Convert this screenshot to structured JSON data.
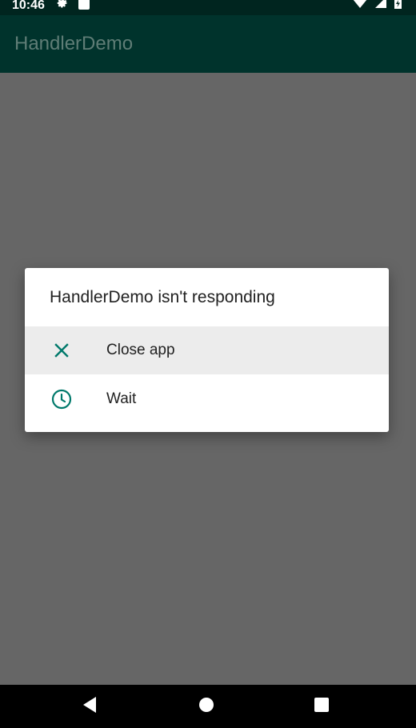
{
  "status_bar": {
    "time": "10:46",
    "left_icons": [
      "gear-icon",
      "sd-card-icon"
    ],
    "right_icons": [
      "wifi-icon",
      "cell-signal-icon",
      "battery-icon"
    ]
  },
  "app_bar": {
    "title": "HandlerDemo"
  },
  "dialog": {
    "title": "HandlerDemo isn't responding",
    "items": [
      {
        "label": "Close app",
        "icon": "close-icon"
      },
      {
        "label": "Wait",
        "icon": "clock-icon"
      }
    ],
    "accent_color": "#00796b"
  },
  "nav_bar": {
    "buttons": [
      "back-icon",
      "home-icon",
      "recents-icon"
    ]
  }
}
